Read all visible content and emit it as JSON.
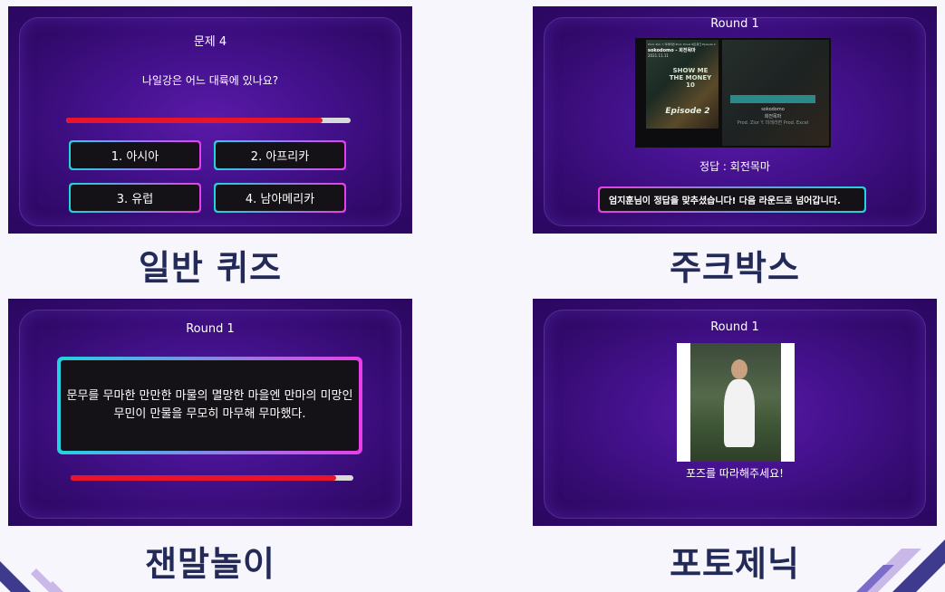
{
  "quiz": {
    "title": "문제 4",
    "question": "나일강은 어느 대륙에 있나요?",
    "progress": 0.9,
    "answers": [
      "1. 아시아",
      "2. 아프리카",
      "3. 유럽",
      "4. 남아메리카"
    ],
    "caption": "일반 퀴즈"
  },
  "jukebox": {
    "title": "Round 1",
    "album_small_text_1": "Prod. Zior Y. 미래라면 Prod. Excel 네트워크 Episode 2",
    "album_artist": "sokodomo - 회전목마",
    "album_date": "2021.11.11",
    "album_show": "SHOW ME THE MONEY 10",
    "album_episode": "Episode 2",
    "side_artist": "sokodomo",
    "side_song": "회전목마",
    "side_credit": "Prod. Zior Y. 미래라면 Prod. Excel",
    "answer": "정답 : 회전목마",
    "notice": "엄지훈님이 정답을 맞추셨습니다! 다음 라운드로 넘어갑니다.",
    "caption": "주크박스"
  },
  "twister": {
    "title": "Round 1",
    "text": "문무를 무마한 만만한 마물의 멸망한 마을엔 만마의 미망인 무민이 만물을 무모히 마무해 무마했다.",
    "progress": 0.94,
    "caption": "잰말놀이"
  },
  "photo": {
    "title": "Round 1",
    "instruction": "포즈를 따라해주세요!",
    "caption": "포토제닉"
  },
  "colors": {
    "panel_bg": "#3a0c78",
    "caption": "#232a57",
    "progress": "#e8142c",
    "gradient_start": "#22d3e0",
    "gradient_end": "#e83ee8",
    "deco_dark": "#3e3a8e",
    "deco_light": "#c9b8e8"
  }
}
